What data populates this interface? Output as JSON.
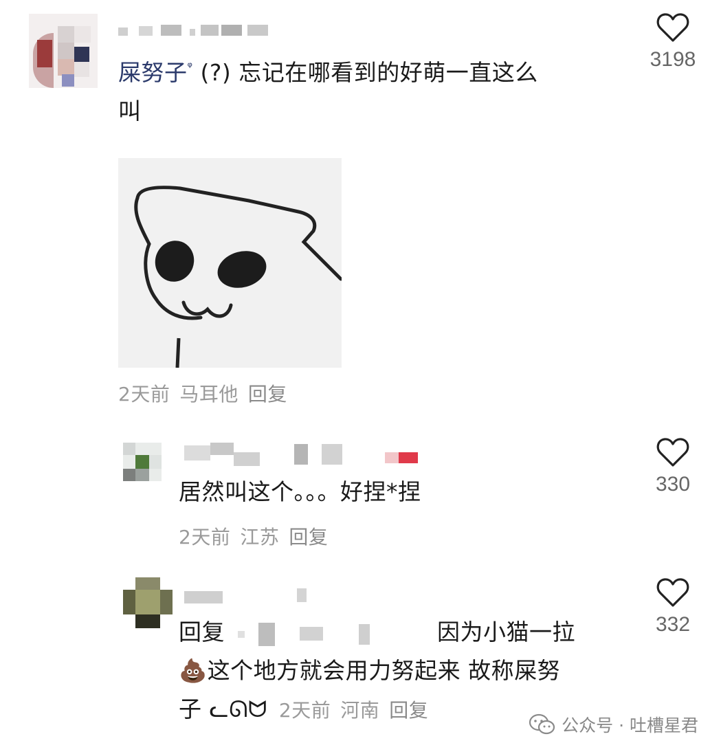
{
  "comments": [
    {
      "author": "屎努子",
      "author_suffix": "ᵠ",
      "text_line1": "(?) 忘记在哪看到的好萌一直这么",
      "text_line2": "叫",
      "date": "2天前",
      "location": "马耳他",
      "reply_label": "回复",
      "likes": "3198"
    },
    {
      "text": "居然叫这个。。。好捏*捏",
      "date": "2天前",
      "location": "江苏",
      "reply_label": "回复",
      "likes": "330"
    },
    {
      "reply_prefix": "回复",
      "text_line1": "因为小猫一拉",
      "text_line2": "这个地方就会用力努起来 故称屎努",
      "text_line3": "子 ᓚᘏᗢ",
      "emoji": "💩",
      "date": "2天前",
      "location": "河南",
      "reply_label": "回复",
      "likes": "332"
    }
  ],
  "watermark": {
    "label": "公众号 · 吐槽星君",
    "icon": "wechat-icon"
  },
  "colors": {
    "author_link": "#2b3a6b",
    "meta_gray": "#9a9a9a",
    "like_gray": "#666666"
  }
}
